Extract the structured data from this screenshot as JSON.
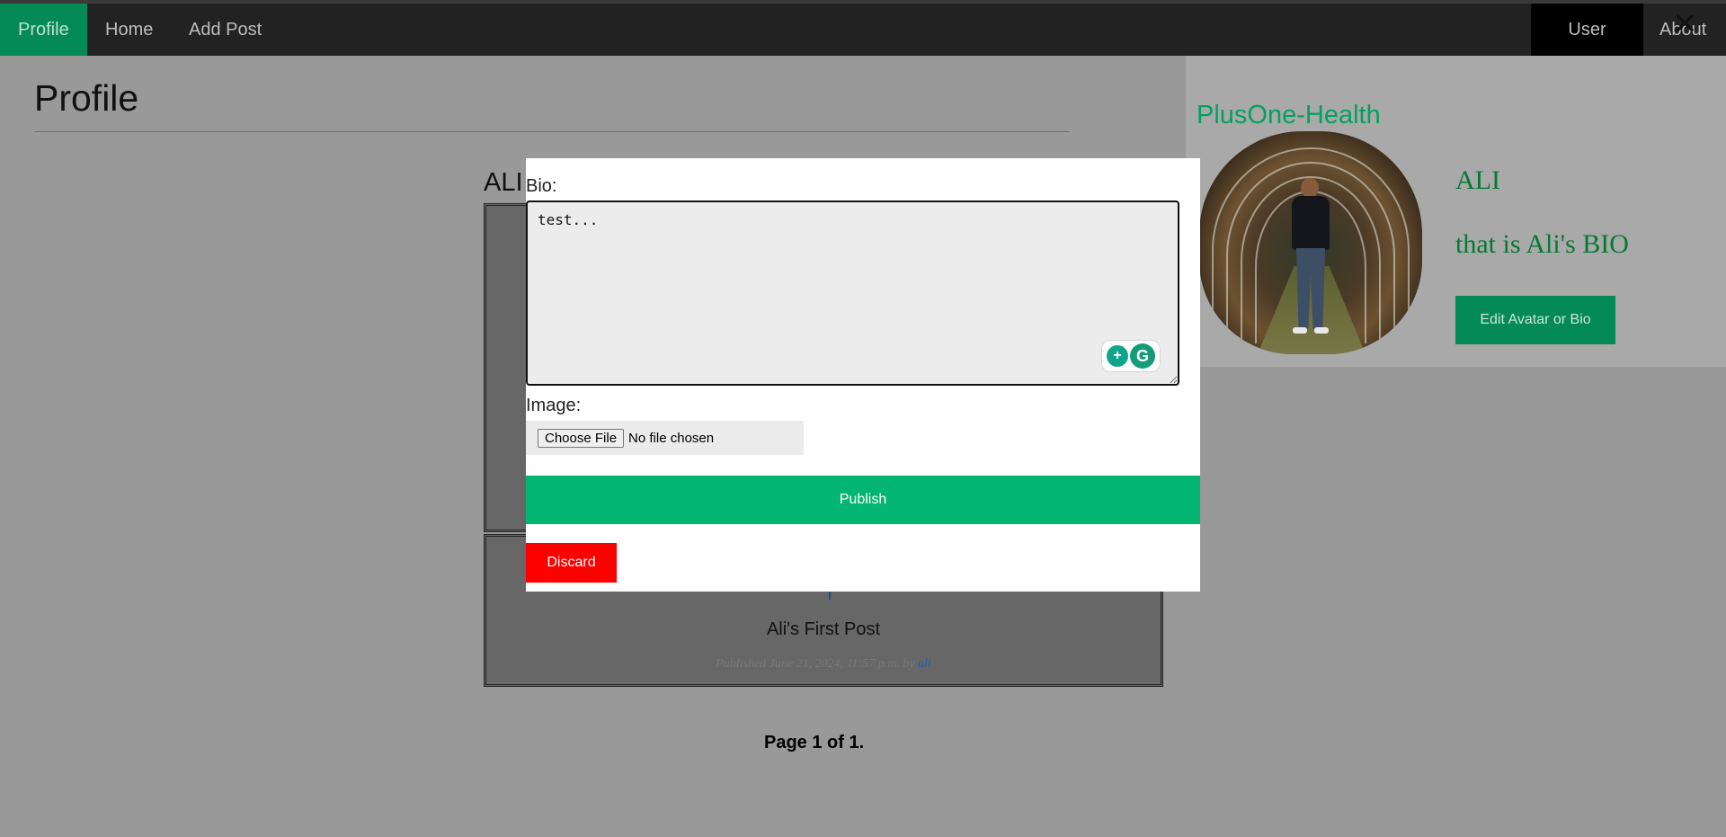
{
  "nav": {
    "profile": "Profile",
    "home": "Home",
    "add_post": "Add Post",
    "user": "User",
    "about": "About"
  },
  "page": {
    "title": "Profile",
    "author_name": "ALI"
  },
  "posts": [
    {
      "title": "Ali's First Post",
      "published_prefix": "Published June 21, 2024, 11:57 p.m. by ",
      "author": "ali"
    }
  ],
  "pagination": {
    "text": "Page 1 of 1."
  },
  "sidebar": {
    "site_name": "PlusOne-Health",
    "profile_name": "ALI",
    "bio": "that is Ali's BIO",
    "edit_button": "Edit Avatar or Bio"
  },
  "modal": {
    "close_symbol": "✕",
    "bio_label": "Bio:",
    "bio_value": "test...",
    "image_label": "Image:",
    "file_button": "Choose File",
    "file_status": "No file chosen",
    "publish_button": "Publish",
    "discard_button": "Discard"
  },
  "icons": {
    "close": "close-icon",
    "grammarly_suggestion": "lightbulb-plus-icon",
    "grammarly_logo": "grammarly-g-icon"
  },
  "colors": {
    "nav_bg": "#222222",
    "nav_active": "#038a56",
    "publish": "#03b573",
    "discard": "#ff0000",
    "brand_green": "#03a063",
    "profile_text": "#037a31"
  }
}
